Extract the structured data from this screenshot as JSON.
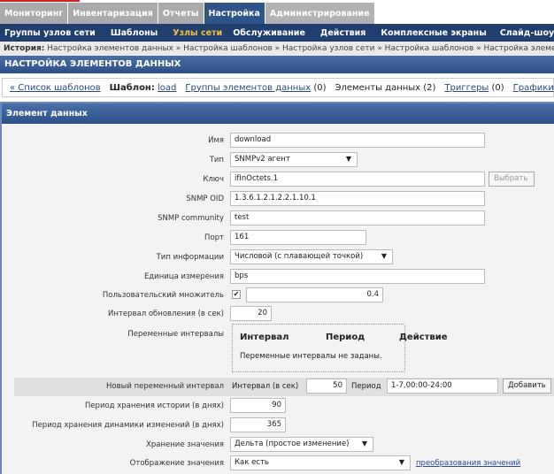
{
  "top_menu": [
    "Мониторинг",
    "Инвентаризация",
    "Отчеты",
    "Настройка",
    "Администрирование"
  ],
  "sub_nav": [
    "Группы узлов сети",
    "Шаблоны",
    "Узлы сети",
    "Обслуживание",
    "Действия",
    "Комплексные экраны",
    "Слайд-шоу"
  ],
  "breadcrumbs": {
    "label": "История:",
    "items": "Настройка элементов данных » Настройка шаблонов » Настройка узлов сети » Настройка шаблонов » Настройка элементов данных"
  },
  "page_title": "НАСТРОЙКА ЭЛЕМЕНТОВ ДАННЫХ",
  "tabs": {
    "back": "« Список шаблонов",
    "template_label": "Шаблон:",
    "template": "load",
    "groups": "Группы элементов данных",
    "groups_count": "(0)",
    "items": "Элементы данных (2)",
    "triggers": "Триггеры",
    "triggers_count": "(0)",
    "graphs": "Графики"
  },
  "form": {
    "title": "Элемент данных",
    "name_label": "Имя",
    "name": "download",
    "type_label": "Тип",
    "type": "SNMPv2 агент",
    "key_label": "Ключ",
    "key": "ifInOctets.1",
    "select_button": "Выбрать",
    "oid_label": "SNMP OID",
    "oid": "1.3.6.1.2.1.2.2.1.10.1",
    "community_label": "SNMP community",
    "community": "test",
    "port_label": "Порт",
    "port": "161",
    "info_type_label": "Тип информации",
    "info_type": "Числовой (с плавающей точкой)",
    "units_label": "Единица измерения",
    "units": "bps",
    "multiplier_label": "Пользовательский множитель",
    "multiplier": "0.4",
    "multiplier_checked": true,
    "update_label": "Интервал обновления (в сек)",
    "update": "20",
    "flex_label": "Переменные интервалы",
    "flex_cols": [
      "Интервал",
      "Период",
      "Действие"
    ],
    "flex_empty": "Переменные интервалы не заданы.",
    "new_flex_label": "Новый переменный интервал",
    "new_interval_label": "Интервал (в сек)",
    "new_interval": "50",
    "new_period_label": "Период",
    "new_period": "1-7,00:00-24:00",
    "add_button": "Добавить",
    "history_label": "Период хранения истории (в днях)",
    "history": "90",
    "trends_label": "Период хранения динамики изменений (в днях)",
    "trends": "365",
    "store_label": "Хранение значения",
    "store": "Дельта (простое изменение)",
    "show_label": "Отображение значения",
    "show": "Как есть",
    "valuemap_link": "преобразования значений"
  }
}
